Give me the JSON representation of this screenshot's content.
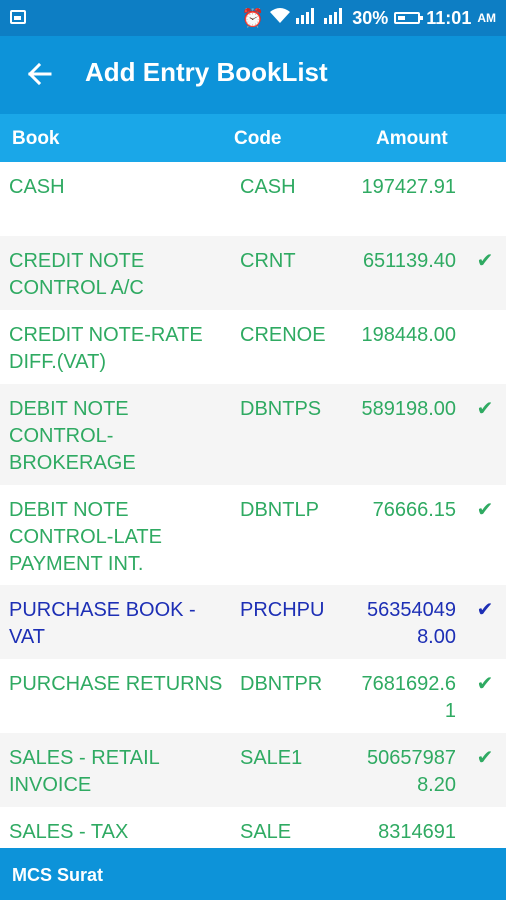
{
  "status_bar": {
    "battery_percent": "30%",
    "time": "11:01",
    "ampm": "AM",
    "icons": [
      "image-icon",
      "alarm-icon",
      "wifi-icon",
      "signal-icon",
      "signal-icon",
      "battery-icon"
    ]
  },
  "app_bar": {
    "title": "Add Entry BookList",
    "back_icon": "arrow-left-icon"
  },
  "table": {
    "headers": {
      "book": "Book",
      "code": "Code",
      "amount": "Amount"
    },
    "rows": [
      {
        "book": "CASH",
        "code": "CASH",
        "amount": "197427.91",
        "checked": "",
        "selected": false
      },
      {
        "book": "CREDIT NOTE CONTROL A/C",
        "code": "CRNT",
        "amount": "651139.40",
        "checked": "✔",
        "selected": false
      },
      {
        "book": "CREDIT NOTE-RATE DIFF.(VAT)",
        "code": "CRENOE",
        "amount": "198448.00",
        "checked": "",
        "selected": false
      },
      {
        "book": "DEBIT NOTE CONTROL-BROKERAGE",
        "code": "DBNTPS",
        "amount": "589198.00",
        "checked": "✔",
        "selected": false
      },
      {
        "book": "DEBIT NOTE CONTROL-LATE PAYMENT INT.",
        "code": "DBNTLP",
        "amount": "76666.15",
        "checked": "✔",
        "selected": false
      },
      {
        "book": "PURCHASE BOOK - VAT",
        "code": "PRCHPU",
        "amount": "563540498.00",
        "checked": "✔",
        "selected": true
      },
      {
        "book": "PURCHASE RETURNS",
        "code": "DBNTPR",
        "amount": "7681692.61",
        "checked": "✔",
        "selected": false
      },
      {
        "book": "SALES - RETAIL INVOICE",
        "code": "SALE1",
        "amount": "506579878.20",
        "checked": "✔",
        "selected": false
      },
      {
        "book": "SALES - TAX",
        "code": "SALE",
        "amount": "8314691",
        "checked": "",
        "selected": false
      }
    ]
  },
  "footer": {
    "label": "MCS Surat"
  },
  "colors": {
    "status_bar": "#0d7ec4",
    "app_bar": "#0d93d9",
    "header": "#1aa7e8",
    "row_text": "#2faa62",
    "selected_text": "#1d2fb5",
    "alt_row": "#f5f5f5"
  }
}
